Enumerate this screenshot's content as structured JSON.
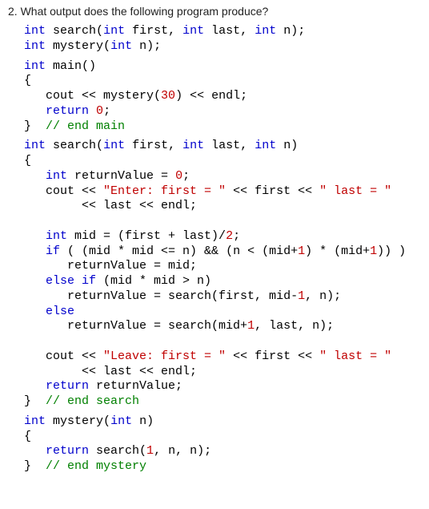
{
  "question": "2. What output does the following program produce?",
  "code": {
    "decl1": {
      "kw_int1": "int",
      "id_search": "search",
      "p1": "(",
      "kw_int2": "int",
      "id_first": "first",
      "c1": ",",
      "kw_int3": "int",
      "id_last": "last",
      "c2": ",",
      "kw_int4": "int",
      "id_n": "n",
      "p2": ");"
    },
    "decl2": {
      "kw_int1": "int",
      "id_mystery": "mystery",
      "p1": "(",
      "kw_int2": "int",
      "id_n": "n",
      "p2": ");"
    },
    "main_head": {
      "kw_int": "int",
      "id": "main",
      "parens": "()"
    },
    "brace_open": "{",
    "brace_close": "}",
    "main_body": {
      "l1a": "cout << mystery(",
      "l1num": "30",
      "l1b": ") << endl;",
      "l2kw": "return",
      "l2num": "0",
      "l2p": ";"
    },
    "cmt_main": "// end main",
    "search_head": {
      "kw_int1": "int",
      "id_search": "search",
      "p1": "(",
      "kw_int2": "int",
      "id_first": "first",
      "c1": ",",
      "kw_int3": "int",
      "id_last": "last",
      "c2": ",",
      "kw_int4": "int",
      "id_n": "n",
      "p2": ")"
    },
    "search_body": {
      "l1kw": "int",
      "l1a": " returnValue = ",
      "l1num": "0",
      "l1p": ";",
      "l2a": "cout << ",
      "l2s1": "\"Enter: first = \"",
      "l2b": " << first << ",
      "l2s2": "\" last = \"",
      "l3a": "     << last << endl;",
      "l4kw": "int",
      "l4a": " mid = (first + last)/",
      "l4num": "2",
      "l4p": ";",
      "l5kw": "if",
      "l5a": " ( (mid * mid <= n) && (n < (mid+",
      "l5n1": "1",
      "l5b": ") * (mid+",
      "l5n2": "1",
      "l5c": ")) )",
      "l6a": "   returnValue = mid;",
      "l7kw": "else if",
      "l7a": " (mid * mid > n)",
      "l8a": "   returnValue = search(first, mid-",
      "l8n": "1",
      "l8b": ", n);",
      "l9kw": "else",
      "l10a": "   returnValue = search(mid+",
      "l10n": "1",
      "l10b": ", last, n);",
      "l11a": "cout << ",
      "l11s1": "\"Leave: first = \"",
      "l11b": " << first << ",
      "l11s2": "\" last = \"",
      "l12a": "     << last << endl;",
      "l13kw": "return",
      "l13a": " returnValue;"
    },
    "cmt_search": "// end search",
    "mystery_head": {
      "kw_int1": "int",
      "id": "mystery",
      "p1": "(",
      "kw_int2": "int",
      "id_n": "n",
      "p2": ")"
    },
    "mystery_body": {
      "l1kw": "return",
      "l1a": " search(",
      "l1n": "1",
      "l1b": ", n, n);"
    },
    "cmt_mystery": "// end mystery"
  }
}
